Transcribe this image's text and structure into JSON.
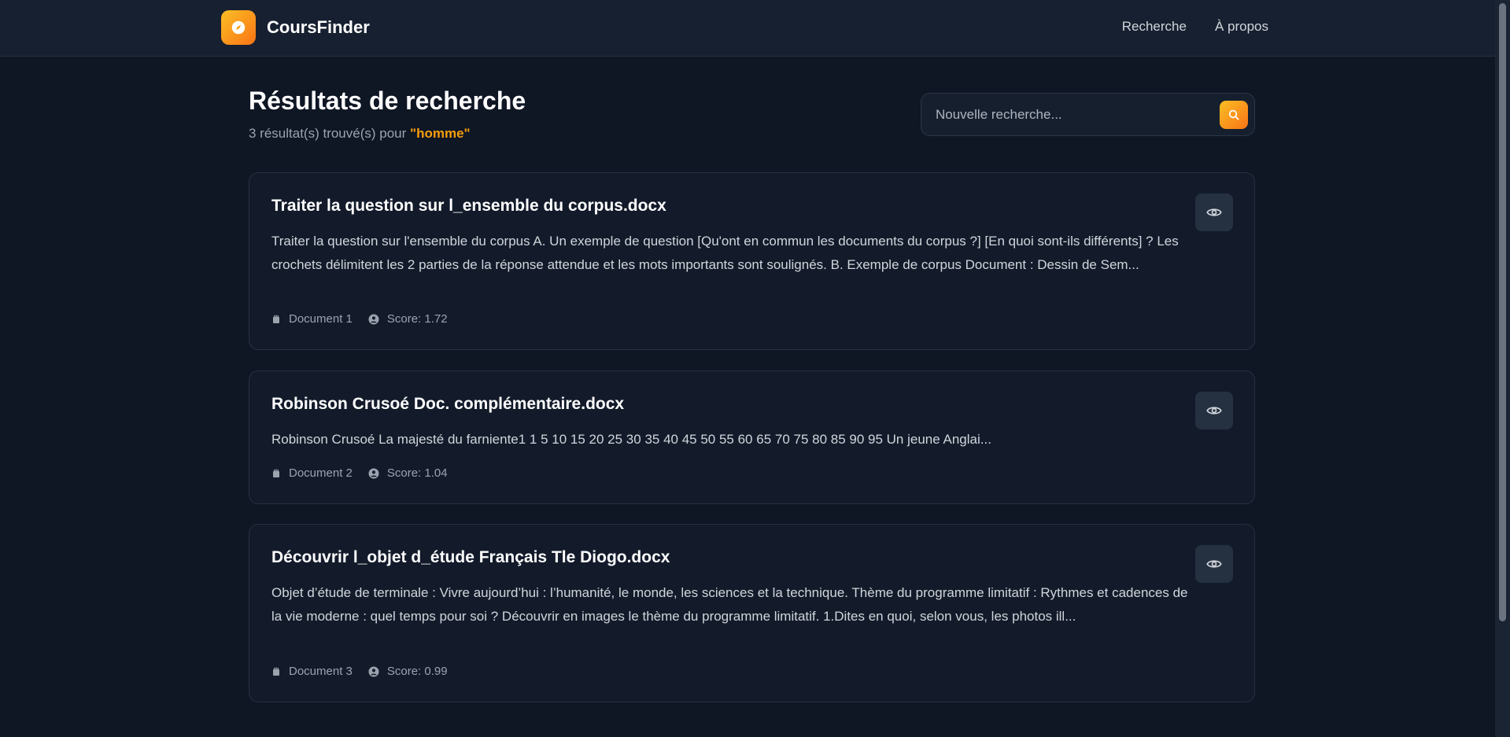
{
  "navbar": {
    "brand": "CoursFinder",
    "links": [
      {
        "label": "Recherche"
      },
      {
        "label": "À propos"
      }
    ]
  },
  "header": {
    "title": "Résultats de recherche",
    "count_text": "3 résultat(s) trouvé(s) pour ",
    "query": "\"homme\""
  },
  "search": {
    "placeholder": "Nouvelle recherche..."
  },
  "results": [
    {
      "title": "Traiter la question sur l_ensemble du corpus.docx",
      "snippet": "Traiter la question sur l'ensemble du corpus A. Un exemple de question [Qu'ont en commun les documents du corpus ?] [En quoi sont-ils différents] ? Les crochets délimitent les 2 parties de la réponse attendue et les mots importants sont soulignés. B. Exemple de corpus Document : Dessin de Sem...",
      "document": "Document 1",
      "score": "Score: 1.72"
    },
    {
      "title": "Robinson Crusoé Doc. complémentaire.docx",
      "snippet": "Robinson Crusoé La majesté du farniente1 1 5 10 15 20 25 30 35 40 45 50 55 60 65 70 75 80 85 90 95 Un jeune Anglai...",
      "document": "Document 2",
      "score": "Score: 1.04"
    },
    {
      "title": "Découvrir l_objet d_étude Français Tle Diogo.docx",
      "snippet": "Objet d’étude de terminale : Vivre aujourd’hui : l’humanité, le monde, les sciences et la technique. Thème du programme limitatif : Rythmes et cadences de la vie moderne : quel temps pour soi ? Découvrir en images le thème du programme limitatif. 1.Dites en quoi, selon vous, les photos ill...",
      "document": "Document 3",
      "score": "Score: 0.99"
    }
  ],
  "icons": {
    "logo": "compass-icon",
    "search": "search-icon",
    "view": "eye-icon",
    "document": "document-icon",
    "score": "user-circle-icon"
  },
  "colors": {
    "accent": "#f59e0b",
    "accent_gradient_end": "#f97316",
    "background": "#0f1624",
    "card": "#131b2b"
  }
}
